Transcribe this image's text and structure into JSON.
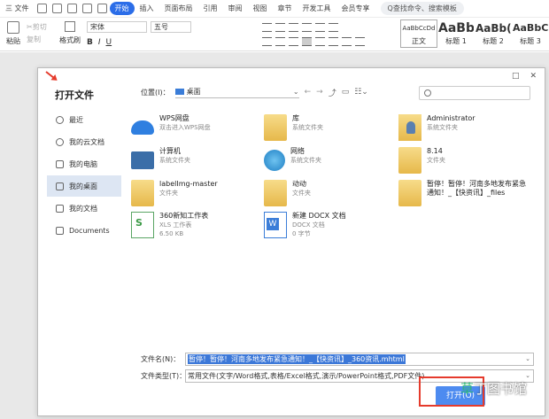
{
  "menubar": {
    "file": "三 文件",
    "start": "开始",
    "insert": "插入",
    "layout": "页面布局",
    "ref": "引用",
    "review": "审阅",
    "view": "视图",
    "section": "章节",
    "dev": "开发工具",
    "member": "会员专享",
    "search": "Q查找命令、搜索模板"
  },
  "ribbon": {
    "paste": "粘贴",
    "cut": "✂剪切",
    "copy": "复制",
    "format_painter": "格式刷",
    "font": "宋体",
    "size": "五号",
    "bold": "B",
    "italic": "I",
    "underline": "U",
    "styles": [
      {
        "preview": "AaBbCcDd",
        "label": "正文"
      },
      {
        "preview": "AaBb",
        "label": "标题 1"
      },
      {
        "preview": "AaBb(",
        "label": "标题 2"
      },
      {
        "preview": "AaBbC",
        "label": "标题 3"
      }
    ]
  },
  "dialog": {
    "title": "打开文件",
    "location_label": "位置(I)：",
    "location_value": "桌面",
    "sidebar": [
      {
        "label": "最近"
      },
      {
        "label": "我的云文档"
      },
      {
        "label": "我的电脑"
      },
      {
        "label": "我的桌面"
      },
      {
        "label": "我的文档"
      },
      {
        "label": "Documents"
      }
    ],
    "files": [
      {
        "name": "WPS网盘",
        "sub": "双击进入WPS网盘",
        "icon": "cloud-icon"
      },
      {
        "name": "库",
        "sub": "系统文件夹",
        "icon": "library-icon"
      },
      {
        "name": "Administrator",
        "sub": "系统文件夹",
        "icon": "user-folder-icon"
      },
      {
        "name": "计算机",
        "sub": "系统文件夹",
        "icon": "computer-icon"
      },
      {
        "name": "网络",
        "sub": "系统文件夹",
        "icon": "network-icon"
      },
      {
        "name": "8.14",
        "sub": "文件夹",
        "icon": "folder-icon"
      },
      {
        "name": "labelImg-master",
        "sub": "文件夹",
        "icon": "folder-icon"
      },
      {
        "name": "动动",
        "sub": "文件夹",
        "icon": "folder-icon"
      },
      {
        "name": "暂停！暂停！河南多地发布紧急",
        "sub": "通知！_【快资讯】_files",
        "icon": "folder-icon"
      },
      {
        "name": "360新知工作表",
        "sub": "XLS 工作表",
        "sub2": "6.50 KB",
        "icon": "xls-icon"
      },
      {
        "name": "新建 DOCX 文档",
        "sub": "DOCX 文档",
        "sub2": "0 字节",
        "icon": "docx-icon"
      }
    ],
    "filename_label": "文件名(N)：",
    "filename_value": "暂停！暂停！河南多地发布紧急通知！_【快资讯】_360资讯.mhtml",
    "filetype_label": "文件类型(T)：",
    "filetype_value": "常用文件(文字/Word格式,表格/Excel格式,演示/PowerPoint格式,PDF文件)",
    "open_button": "打开(O)"
  },
  "watermark": {
    "g": "草",
    "rest": "丁图书馆"
  }
}
